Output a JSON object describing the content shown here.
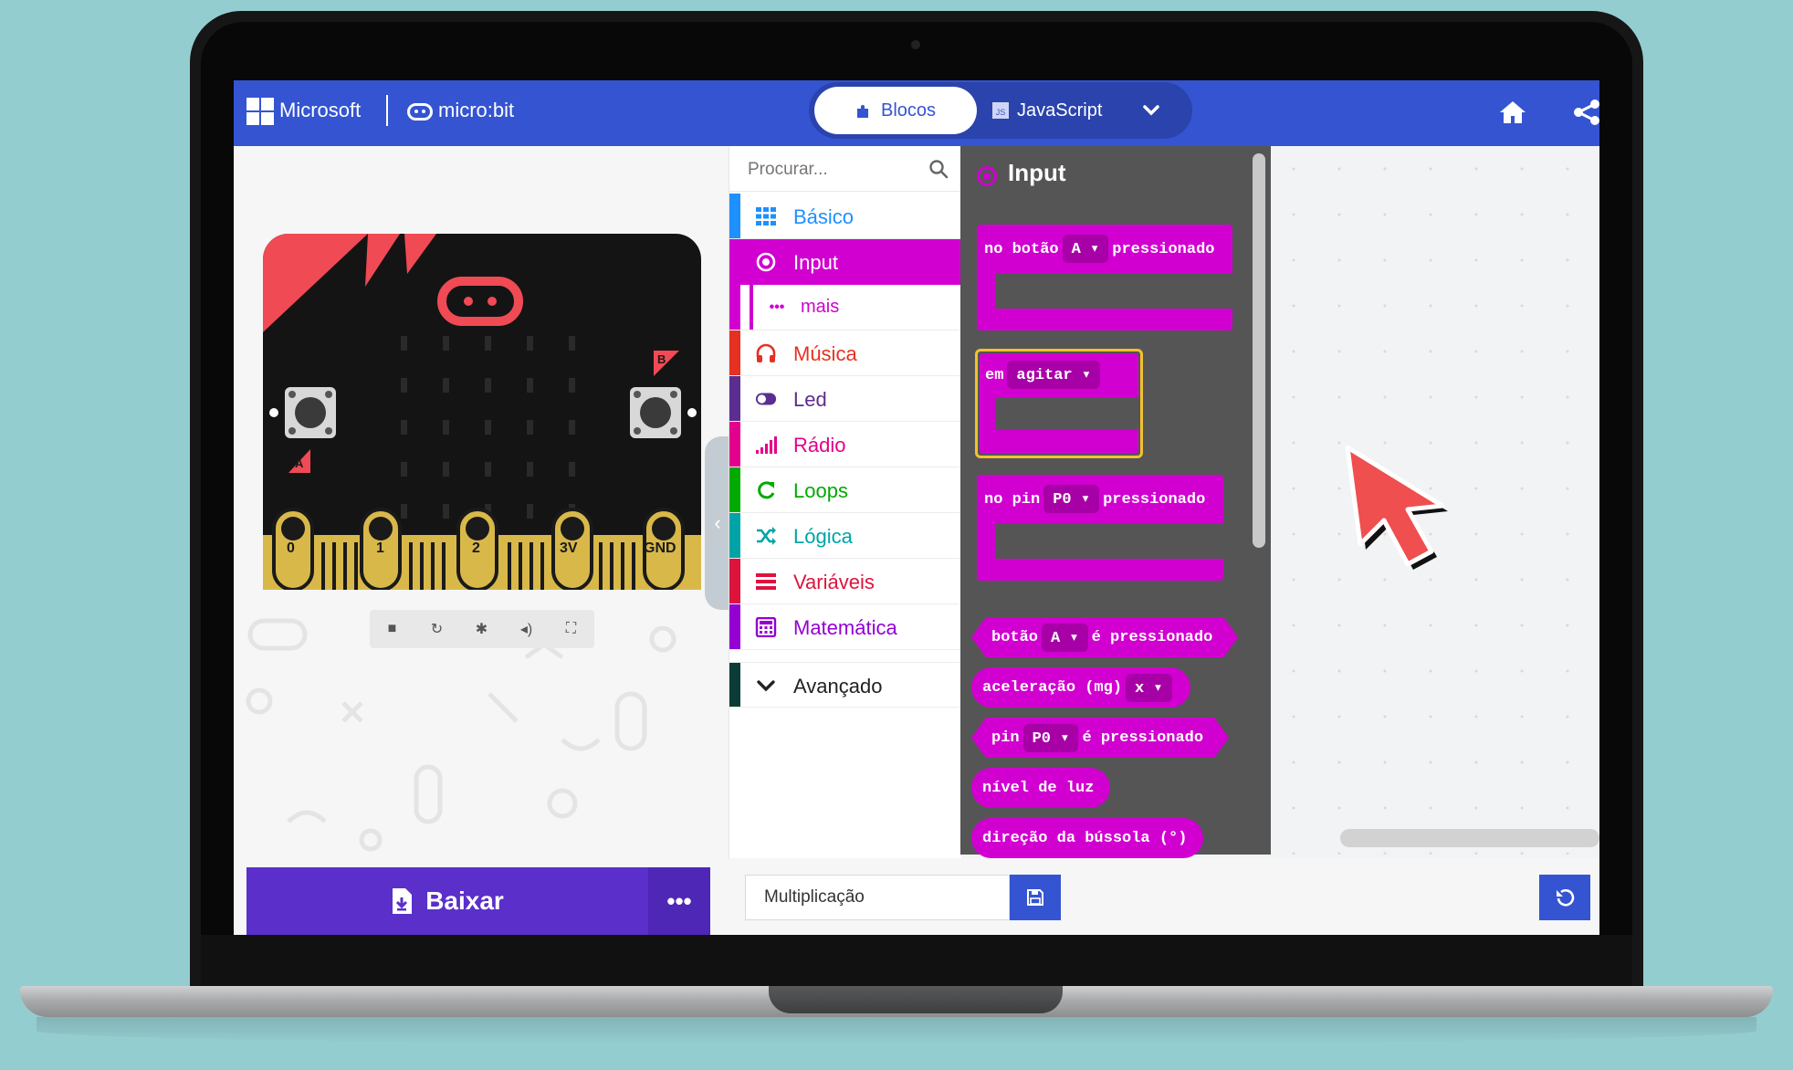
{
  "header": {
    "brand_microsoft": "Microsoft",
    "brand_microbit": "micro:bit",
    "tabs": [
      {
        "label": "Blocos",
        "active": true
      },
      {
        "label": "JavaScript",
        "active": false
      }
    ],
    "icons": [
      "home-icon",
      "share-icon",
      "chevron-down-icon"
    ],
    "color": "#3454d1"
  },
  "simulator": {
    "pins": [
      "0",
      "1",
      "2",
      "3V",
      "GND"
    ],
    "buttons": [
      "A",
      "B"
    ],
    "controls": [
      "stop-icon",
      "restart-icon",
      "debug-icon",
      "sound-icon",
      "fullscreen-icon"
    ]
  },
  "toolbox": {
    "search_placeholder": "Procurar...",
    "categories": [
      {
        "label": "Básico",
        "color": "#1e90ff",
        "icon": "grid-icon"
      },
      {
        "label": "Input",
        "color": "#d100d1",
        "icon": "target-icon",
        "selected": true
      },
      {
        "label": "mais",
        "color": "#d100d1",
        "icon": "more-icon",
        "sub": true
      },
      {
        "label": "Música",
        "color": "#e63022",
        "icon": "headphones-icon"
      },
      {
        "label": "Led",
        "color": "#5c2d91",
        "icon": "toggle-icon"
      },
      {
        "label": "Rádio",
        "color": "#e3008c",
        "icon": "signal-icon"
      },
      {
        "label": "Loops",
        "color": "#00aa00",
        "icon": "loop-icon"
      },
      {
        "label": "Lógica",
        "color": "#00a4a6",
        "icon": "shuffle-icon"
      },
      {
        "label": "Variáveis",
        "color": "#dc143c",
        "icon": "lines-icon"
      },
      {
        "label": "Matemática",
        "color": "#9400d3",
        "icon": "calculator-icon"
      },
      {
        "label": "Avançado",
        "color": "#0b3d36",
        "icon": "chevron-down-icon"
      }
    ]
  },
  "flyout": {
    "title": "Input",
    "color": "#d100d1",
    "blocks": {
      "button_event": {
        "prefix": "no botão",
        "dropdown": "A",
        "suffix": "pressionado"
      },
      "gesture_event": {
        "prefix": "em",
        "dropdown": "agitar"
      },
      "pin_event": {
        "prefix": "no pin",
        "dropdown": "P0",
        "suffix": "pressionado"
      },
      "button_pressed": {
        "prefix": "botão",
        "dropdown": "A",
        "suffix": "é pressionado"
      },
      "acceleration": {
        "prefix": "aceleração (mg)",
        "dropdown": "x"
      },
      "pin_pressed": {
        "prefix": "pin",
        "dropdown": "P0",
        "suffix": "é pressionado"
      },
      "light_level": {
        "label": "nível de luz"
      },
      "compass": {
        "label": "direção da bússola (°)"
      }
    }
  },
  "bottom": {
    "download_label": "Baixar",
    "more_label": "•••",
    "project_name": "Multiplicação",
    "icons": [
      "download-file-icon",
      "save-icon",
      "undo-icon"
    ]
  }
}
